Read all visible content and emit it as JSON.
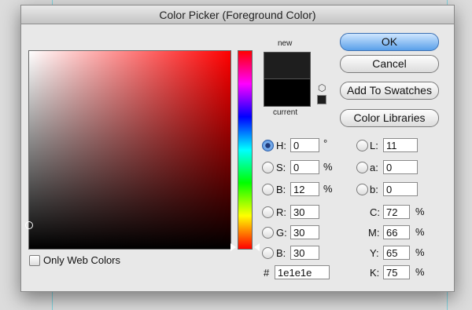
{
  "dialog": {
    "title": "Color Picker (Foreground Color)"
  },
  "preview": {
    "new_label": "new",
    "current_label": "current",
    "new_color": "#1e1e1e",
    "current_color": "#000000"
  },
  "buttons": {
    "ok": "OK",
    "cancel": "Cancel",
    "add_swatches": "Add To Swatches",
    "color_libraries": "Color Libraries"
  },
  "hsb": {
    "h": {
      "label": "H:",
      "value": "0",
      "unit": "°"
    },
    "s": {
      "label": "S:",
      "value": "0",
      "unit": "%"
    },
    "b": {
      "label": "B:",
      "value": "12",
      "unit": "%"
    }
  },
  "rgb": {
    "r": {
      "label": "R:",
      "value": "30"
    },
    "g": {
      "label": "G:",
      "value": "30"
    },
    "b": {
      "label": "B:",
      "value": "30"
    }
  },
  "lab": {
    "l": {
      "label": "L:",
      "value": "11"
    },
    "a": {
      "label": "a:",
      "value": "0"
    },
    "b": {
      "label": "b:",
      "value": "0"
    }
  },
  "cmyk": {
    "c": {
      "label": "C:",
      "value": "72",
      "unit": "%"
    },
    "m": {
      "label": "M:",
      "value": "66",
      "unit": "%"
    },
    "y": {
      "label": "Y:",
      "value": "65",
      "unit": "%"
    },
    "k": {
      "label": "K:",
      "value": "75",
      "unit": "%"
    }
  },
  "hex": {
    "label": "#",
    "value": "1e1e1e"
  },
  "web_colors": {
    "label": "Only Web Colors"
  },
  "colors": {
    "hue_base": "#ff0000",
    "accent": "#5aa0ea"
  }
}
